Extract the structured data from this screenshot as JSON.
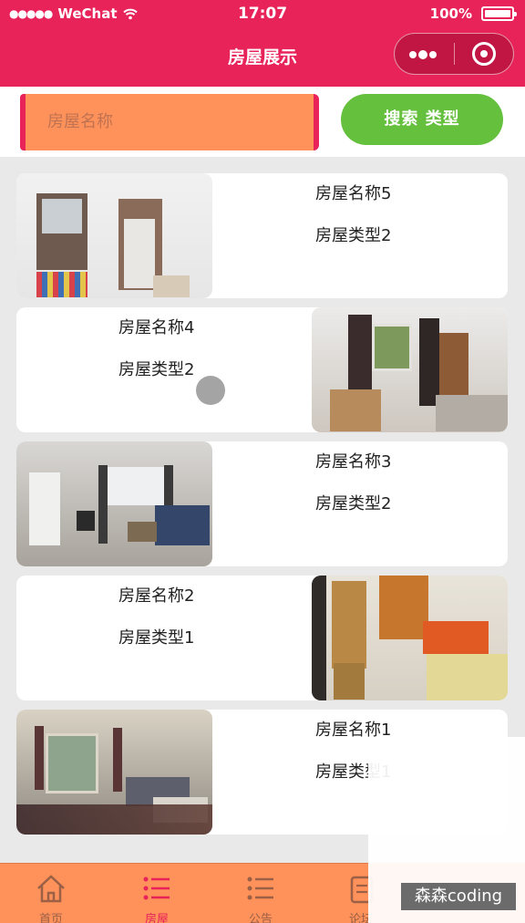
{
  "status_bar": {
    "carrier": "WeChat",
    "signal_dots": "●●●●●",
    "time": "17:07",
    "battery": "100%"
  },
  "nav": {
    "title": "房屋展示"
  },
  "search": {
    "placeholder": "房屋名称",
    "button_label": "搜索  类型"
  },
  "houses": [
    {
      "name": "房屋名称5",
      "type": "房屋类型2",
      "image_side": "left"
    },
    {
      "name": "房屋名称4",
      "type": "房屋类型2",
      "image_side": "right"
    },
    {
      "name": "房屋名称3",
      "type": "房屋类型2",
      "image_side": "left"
    },
    {
      "name": "房屋名称2",
      "type": "房屋类型1",
      "image_side": "right"
    },
    {
      "name": "房屋名称1",
      "type": "房屋类型1",
      "image_side": "left"
    }
  ],
  "tabs": [
    {
      "label": "首页",
      "icon": "home-icon",
      "active": false
    },
    {
      "label": "房屋",
      "icon": "list-icon",
      "active": true
    },
    {
      "label": "公告",
      "icon": "list-icon",
      "active": false
    },
    {
      "label": "论坛",
      "icon": "clipboard-icon",
      "active": false
    }
  ],
  "watermark": "森森coding",
  "colors": {
    "primary": "#e8235a",
    "accent": "#ff915a",
    "button": "#65c03e",
    "background": "#e9e9e9"
  }
}
